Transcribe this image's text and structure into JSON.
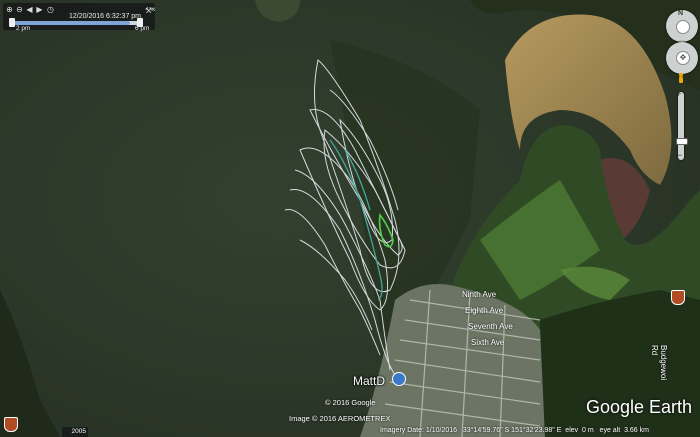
{
  "time_slider": {
    "date_time": "12/20/2016 6:32:37 pm",
    "start_label": "2 pm",
    "end_label": "6 pm",
    "progress_fraction": 0.9
  },
  "labels": {
    "marker_name": "MattD",
    "streets": [
      "Ninth Ave",
      "Eighth Ave",
      "Seventh Ave",
      "Sixth Ave",
      "Budgewoi Rd"
    ],
    "road_shield_left": "",
    "road_shield_right": ""
  },
  "attribution": {
    "copyright_google": "© 2016 Google",
    "image_credit": "Image © 2016 AEROMETREX",
    "logo": "Google Earth",
    "year_badge": "2005"
  },
  "status_bar": {
    "imagery_date": "Imagery Date: 1/10/2016",
    "coordinates": "33°14'59.76\" S  151°32'23.98\" E",
    "elev_label": "elev",
    "elev_value": "0 m",
    "eye_alt_label": "eye alt",
    "eye_alt_value": "3.66 km"
  },
  "icons": {
    "nav": "compass-icon",
    "look": "look-joystick-icon",
    "pegman": "pegman-icon",
    "zoom": "zoom-slider-icon",
    "pin": "placemark-pin-icon"
  },
  "colors": {
    "water": "#2e3b2a",
    "track_white": "#e8ecef",
    "track_teal": "#43a6a0",
    "track_green": "#4fd24a",
    "sand": "#a9894f"
  }
}
